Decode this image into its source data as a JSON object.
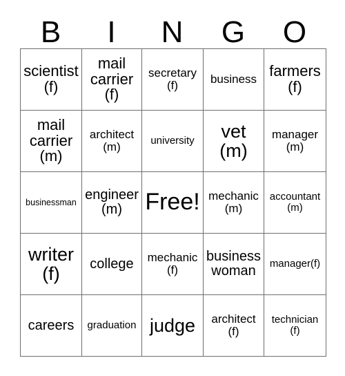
{
  "card": {
    "title": "BINGO",
    "header_letters": [
      "B",
      "I",
      "N",
      "G",
      "O"
    ],
    "columns": 5,
    "rows": 5,
    "border_color": "#6e6e6e",
    "text_color": "#000000",
    "background_color": "#ffffff",
    "free_space": {
      "row": 2,
      "column": 2,
      "label": "Free!"
    },
    "cells": [
      [
        {
          "text": "scientist\n(f)",
          "size": "l"
        },
        {
          "text": "mail\ncarrier\n(f)",
          "size": "l"
        },
        {
          "text": "secretary\n(f)",
          "size": "s"
        },
        {
          "text": "business",
          "size": "s"
        },
        {
          "text": "farmers\n(f)",
          "size": "l"
        }
      ],
      [
        {
          "text": "mail\ncarrier\n(m)",
          "size": "l"
        },
        {
          "text": "architect\n(m)",
          "size": "s"
        },
        {
          "text": "university",
          "size": "xs"
        },
        {
          "text": "vet\n(m)",
          "size": "xl"
        },
        {
          "text": "manager\n(m)",
          "size": "s"
        }
      ],
      [
        {
          "text": "businessman",
          "size": "xxs"
        },
        {
          "text": "engineer\n(m)",
          "size": "m"
        },
        {
          "text": "Free!",
          "size": "xxl"
        },
        {
          "text": "mechanic\n(m)",
          "size": "s"
        },
        {
          "text": "accountant\n(m)",
          "size": "xs"
        }
      ],
      [
        {
          "text": "writer\n(f)",
          "size": "xl"
        },
        {
          "text": "college",
          "size": "m"
        },
        {
          "text": "mechanic\n(f)",
          "size": "s"
        },
        {
          "text": "business\nwoman",
          "size": "m"
        },
        {
          "text": "manager(f)",
          "size": "xs"
        }
      ],
      [
        {
          "text": "careers",
          "size": "m"
        },
        {
          "text": "graduation",
          "size": "xs"
        },
        {
          "text": "judge",
          "size": "xl"
        },
        {
          "text": "architect\n(f)",
          "size": "s"
        },
        {
          "text": "technician\n(f)",
          "size": "xs"
        }
      ]
    ]
  }
}
